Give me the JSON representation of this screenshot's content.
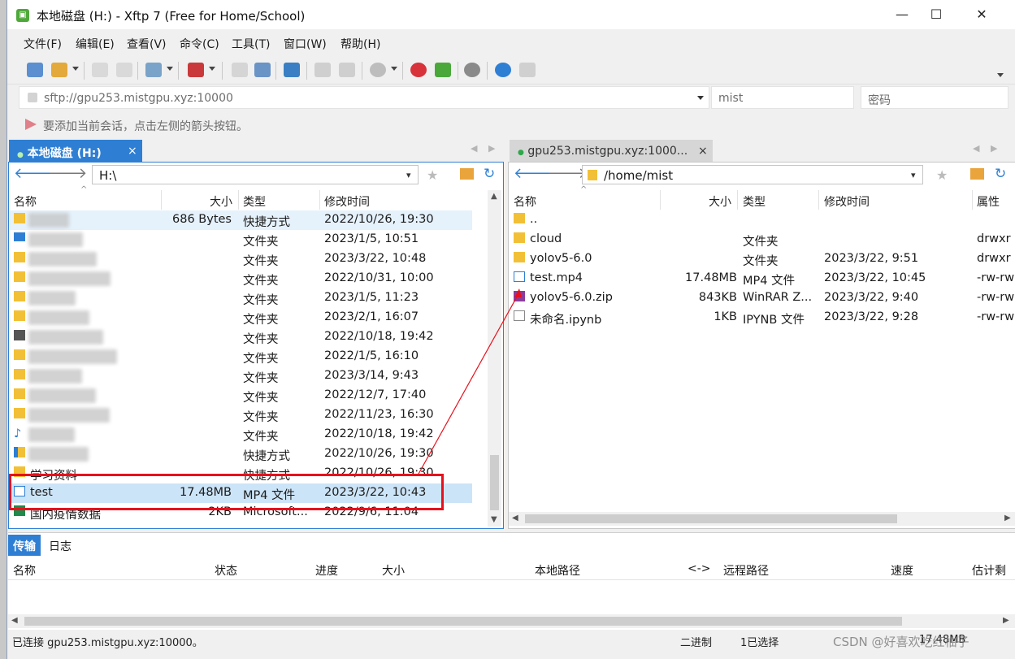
{
  "window": {
    "title": "本地磁盘 (H:) - Xftp 7 (Free for Home/School)",
    "app_icon_text": "▣",
    "minimize": "—",
    "maximize": "☐",
    "close": "✕"
  },
  "menu": [
    "文件(F)",
    "编辑(E)",
    "查看(V)",
    "命令(C)",
    "工具(T)",
    "窗口(W)",
    "帮助(H)"
  ],
  "address": {
    "url": "sftp://gpu253.mistgpu.xyz:10000",
    "username": "mist",
    "password_placeholder": "密码"
  },
  "notice": "要添加当前会话，点击左侧的箭头按钮。",
  "left_pane": {
    "tab_label": "本地磁盘 (H:)",
    "tab_close": "×",
    "path": "H:\\",
    "columns": [
      "名称",
      "大小",
      "类型",
      "修改时间"
    ],
    "rows": [
      {
        "name": "",
        "size": "686 Bytes",
        "type": "快捷方式",
        "date": "2022/10/26, 19:30",
        "icon": "folder"
      },
      {
        "name": "",
        "size": "",
        "type": "文件夹",
        "date": "2023/1/5, 10:51",
        "icon": "desktop"
      },
      {
        "name": "",
        "size": "",
        "type": "文件夹",
        "date": "2023/3/22, 10:48",
        "icon": "folder"
      },
      {
        "name": "",
        "size": "",
        "type": "文件夹",
        "date": "2022/10/31, 10:00",
        "icon": "folder"
      },
      {
        "name": "",
        "size": "",
        "type": "文件夹",
        "date": "2023/1/5, 11:23",
        "icon": "folder"
      },
      {
        "name": "",
        "size": "",
        "type": "文件夹",
        "date": "2023/2/1, 16:07",
        "icon": "folder"
      },
      {
        "name": "",
        "size": "",
        "type": "文件夹",
        "date": "2022/10/18, 19:42",
        "icon": "video"
      },
      {
        "name": "",
        "size": "",
        "type": "文件夹",
        "date": "2022/1/5, 16:10",
        "icon": "folder"
      },
      {
        "name": "",
        "size": "",
        "type": "文件夹",
        "date": "2023/3/14, 9:43",
        "icon": "folder"
      },
      {
        "name": "",
        "size": "",
        "type": "文件夹",
        "date": "2022/12/7, 17:40",
        "icon": "folder"
      },
      {
        "name": "",
        "size": "",
        "type": "文件夹",
        "date": "2022/11/23, 16:30",
        "icon": "folder"
      },
      {
        "name": "",
        "size": "",
        "type": "文件夹",
        "date": "2022/10/18, 19:42",
        "icon": "music"
      },
      {
        "name": "",
        "size": "",
        "type": "快捷方式",
        "date": "2022/10/26, 19:30",
        "icon": "shortcut"
      },
      {
        "name": "学习资料",
        "size": "",
        "type": "快捷方式",
        "date": "2022/10/26, 19:30",
        "icon": "folder"
      },
      {
        "name": "test",
        "size": "17.48MB",
        "type": "MP4 文件",
        "date": "2023/3/22, 10:43",
        "icon": "mp4"
      },
      {
        "name": "国内疫情数据",
        "size": "2KB",
        "type": "Microsoft...",
        "date": "2022/9/6, 11:04",
        "icon": "excel"
      }
    ]
  },
  "right_pane": {
    "tab_label": "gpu253.mistgpu.xyz:1000...",
    "tab_close": "×",
    "path": "/home/mist",
    "columns": [
      "名称",
      "大小",
      "类型",
      "修改时间",
      "属性"
    ],
    "rows": [
      {
        "name": "..",
        "size": "",
        "type": "",
        "date": "",
        "attr": "",
        "icon": "folder"
      },
      {
        "name": "cloud",
        "size": "",
        "type": "文件夹",
        "date": "",
        "attr": "drwxr",
        "icon": "folder"
      },
      {
        "name": "yolov5-6.0",
        "size": "",
        "type": "文件夹",
        "date": "2023/3/22, 9:51",
        "attr": "drwxr",
        "icon": "folder"
      },
      {
        "name": "test.mp4",
        "size": "17.48MB",
        "type": "MP4 文件",
        "date": "2023/3/22, 10:45",
        "attr": "-rw-rw",
        "icon": "mp4"
      },
      {
        "name": "yolov5-6.0.zip",
        "size": "843KB",
        "type": "WinRAR Z...",
        "date": "2023/3/22, 9:40",
        "attr": "-rw-rw",
        "icon": "rar"
      },
      {
        "name": "未命名.ipynb",
        "size": "1KB",
        "type": "IPYNB 文件",
        "date": "2023/3/22, 9:28",
        "attr": "-rw-rw",
        "icon": "file"
      }
    ]
  },
  "transfer": {
    "tabs": [
      "传输",
      "日志"
    ],
    "columns": [
      "名称",
      "状态",
      "进度",
      "大小",
      "本地路径",
      "<->",
      "远程路径",
      "速度",
      "估计剩"
    ]
  },
  "statusbar": {
    "connection": "已连接 gpu253.mistgpu.xyz:10000。",
    "mode": "二进制",
    "selected": "1已选择",
    "size": "17.48MB",
    "watermark": "CSDN @好喜欢吃红柚子"
  },
  "colors": {
    "accent": "#2e7fd4",
    "selection": "#cce4f7",
    "annotation_red": "#e8101c",
    "folder": "#f2c037"
  }
}
